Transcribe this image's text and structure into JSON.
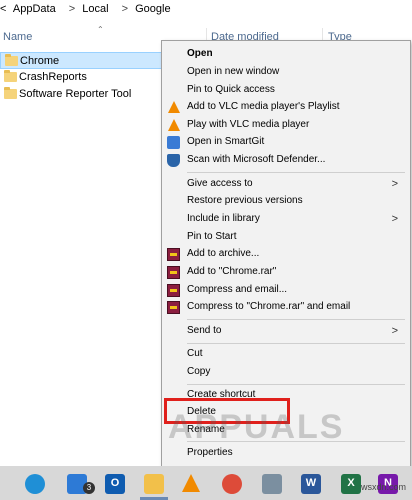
{
  "address": {
    "crumbs": [
      "AppData",
      "Local",
      "Google"
    ],
    "separator": ">",
    "lead": "<"
  },
  "columns": {
    "name": "Name",
    "date_modified": "Date modified",
    "type": "Type"
  },
  "files": [
    {
      "name": "Chrome",
      "selected": true
    },
    {
      "name": "CrashReports",
      "selected": false
    },
    {
      "name": "Software Reporter Tool",
      "selected": false
    }
  ],
  "context_menu": {
    "items": [
      {
        "label": "Open",
        "icon": "none",
        "bold": true
      },
      {
        "label": "Open in new window",
        "icon": "none"
      },
      {
        "label": "Pin to Quick access",
        "icon": "none"
      },
      {
        "label": "Add to VLC media player's Playlist",
        "icon": "vlc-icon"
      },
      {
        "label": "Play with VLC media player",
        "icon": "vlc-icon"
      },
      {
        "label": "Open in SmartGit",
        "icon": "smartgit-icon"
      },
      {
        "label": "Scan with Microsoft Defender...",
        "icon": "defender-icon"
      },
      {
        "label": "Give access to",
        "icon": "none",
        "submenu": true
      },
      {
        "label": "Restore previous versions",
        "icon": "none"
      },
      {
        "label": "Include in library",
        "icon": "none",
        "submenu": true
      },
      {
        "label": "Pin to Start",
        "icon": "none"
      },
      {
        "label": "Add to archive...",
        "icon": "winrar-icon"
      },
      {
        "label": "Add to \"Chrome.rar\"",
        "icon": "winrar-icon"
      },
      {
        "label": "Compress and email...",
        "icon": "winrar-icon"
      },
      {
        "label": "Compress to \"Chrome.rar\" and email",
        "icon": "winrar-icon"
      },
      {
        "label": "Send to",
        "icon": "none",
        "submenu": true
      },
      {
        "label": "Cut",
        "icon": "none"
      },
      {
        "label": "Copy",
        "icon": "none"
      },
      {
        "label": "Create shortcut",
        "icon": "none"
      },
      {
        "label": "Delete",
        "icon": "none",
        "highlighted": true
      },
      {
        "label": "Rename",
        "icon": "none"
      },
      {
        "label": "Properties",
        "icon": "none"
      }
    ],
    "submenu_arrow": ">"
  },
  "taskbar": {
    "mail_badge": "3",
    "word_letter": "W",
    "excel_letter": "X",
    "onenote_letter": "N",
    "outlook_letter": "O"
  },
  "watermark": "APPUALS",
  "site": "wsxdn.com",
  "colors": {
    "selection_bg": "#cce8ff",
    "highlight_border": "#e0201c",
    "menu_bg": "#f2f2f2"
  }
}
